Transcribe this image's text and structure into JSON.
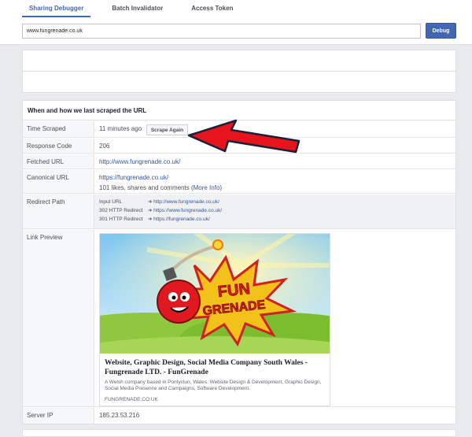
{
  "tabs": [
    {
      "label": "Sharing Debugger",
      "active": true
    },
    {
      "label": "Batch Invalidator",
      "active": false
    },
    {
      "label": "Access Token",
      "active": false
    }
  ],
  "search": {
    "value": "www.fungrenade.co.uk"
  },
  "debug_button": "Debug",
  "section_title": "When and how we last scraped the URL",
  "rows": {
    "time_scraped": {
      "label": "Time Scraped",
      "value": "11 minutes ago",
      "button": "Scrape Again"
    },
    "response_code": {
      "label": "Response Code",
      "value": "206"
    },
    "fetched_url": {
      "label": "Fetched URL",
      "value": "http://www.fungrenade.co.uk/"
    },
    "canonical_url": {
      "label": "Canonical URL",
      "value": "https://fungrenade.co.uk/",
      "likes": "101 likes, shares and comments (",
      "more_info": "More Info",
      "likes_close": ")"
    },
    "redirect_path": {
      "label": "Redirect Path",
      "arrow": "➔",
      "lines": [
        {
          "label": "Input URL",
          "url": "http://www.fungrenade.co.uk/"
        },
        {
          "label": "302 HTTP Redirect",
          "url": "https://www.fungrenade.co.uk/"
        },
        {
          "label": "301 HTTP Redirect",
          "url": "https://fungrenade.co.uk/"
        }
      ]
    },
    "link_preview": {
      "label": "Link Preview",
      "logo_line1": "FUN",
      "logo_line2": "GRENADE",
      "title": "Website, Graphic Design, Social Media Company South Wales - Fungrenade LTD. - FunGrenade",
      "description": "A Welsh company based in Pontyclun, Wales. Website Design & Development, Graphic Design, Social Media Presence and Campaigns, Software Development.",
      "domain": "FUNGRENADE.CO.UK"
    },
    "server_ip": {
      "label": "Server IP",
      "value": "185.23.53.216"
    }
  },
  "colors": {
    "accent": "#4267b2",
    "arrow": "#e8141c",
    "link": "#365899"
  }
}
